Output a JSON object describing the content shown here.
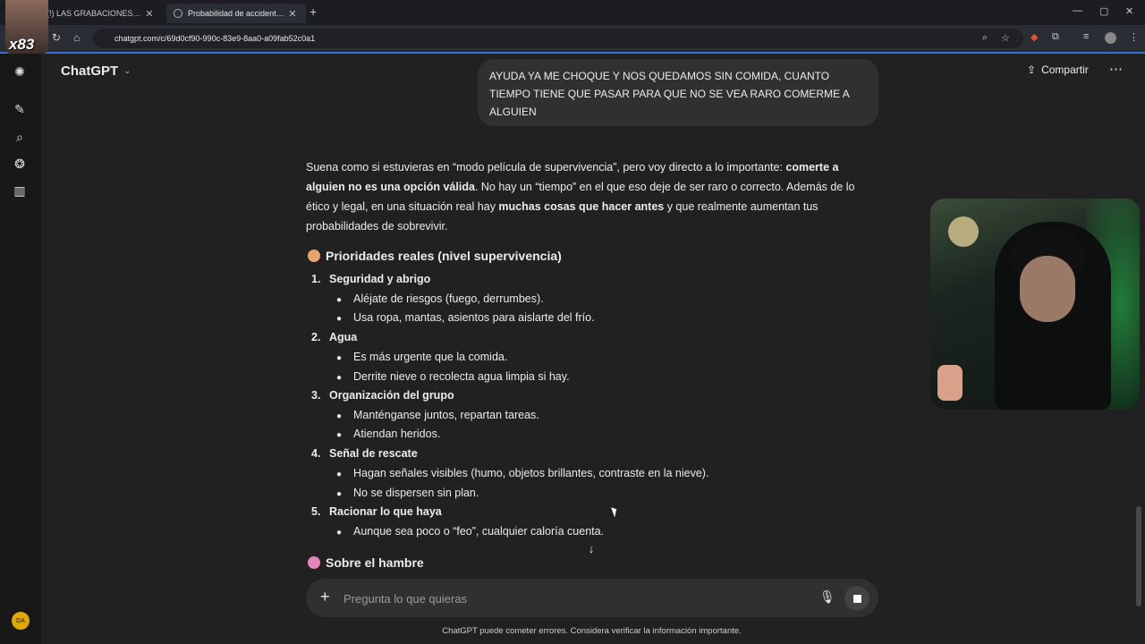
{
  "browser": {
    "tabs": [
      {
        "label": "(!) LAS GRABACIONES DE CA",
        "active": false
      },
      {
        "label": "Probabilidad de accidente aér",
        "active": true
      }
    ],
    "url": "chatgpt.com/c/69d0cf90-990c-83e9-8aa0-a09fab52c0a1",
    "accent": "#3c6ce0"
  },
  "header": {
    "model": "ChatGPT",
    "share_label": "Compartir"
  },
  "streamer_tag": "x83",
  "avatar_initials": "DA",
  "user_message": "AYUDA YA ME CHOQUE Y NOS QUEDAMOS SIN COMIDA, CUANTO TIEMPO TIENE QUE PASAR PARA QUE NO SE VEA RARO COMERME A ALGUIEN",
  "answer": {
    "intro_1": "Suena como si estuvieras en “modo película de supervivencia”, pero voy directo a lo importante: ",
    "intro_bold_1": "comerte a alguien no es una opción válida",
    "intro_2": ". No hay un “tiempo” en el que eso deje de ser raro o correcto. Además de lo ético y legal, en una situación real hay ",
    "intro_bold_2": "muchas cosas que hacer antes",
    "intro_3": " y que realmente aumentan tus probabilidades de sobrevivir.",
    "section_1_title": "Prioridades reales (nivel supervivencia)",
    "items": [
      {
        "num": "1.",
        "title": "Seguridad y abrigo",
        "bullets": [
          "Aléjate de riesgos (fuego, derrumbes).",
          "Usa ropa, mantas, asientos para aislarte del frío."
        ]
      },
      {
        "num": "2.",
        "title": "Agua",
        "bullets": [
          "Es más urgente que la comida.",
          "Derrite nieve o recolecta agua limpia si hay."
        ]
      },
      {
        "num": "3.",
        "title": "Organización del grupo",
        "bullets": [
          "Manténganse juntos, repartan tareas.",
          "Atiendan heridos."
        ]
      },
      {
        "num": "4.",
        "title": "Señal de rescate",
        "bullets": [
          "Hagan señales visibles (humo, objetos brillantes, contraste en la nieve).",
          "No se dispersen sin plan."
        ]
      },
      {
        "num": "5.",
        "title": "Racionar lo que haya",
        "bullets": [
          "Aunque sea poco o “feo”, cualquier caloría cuenta."
        ]
      }
    ],
    "section_2_title": "Sobre el hambre"
  },
  "composer": {
    "placeholder": "Pregunta lo que quieras"
  },
  "disclaimer": "ChatGPT puede cometer errores. Considera verificar la información importante."
}
